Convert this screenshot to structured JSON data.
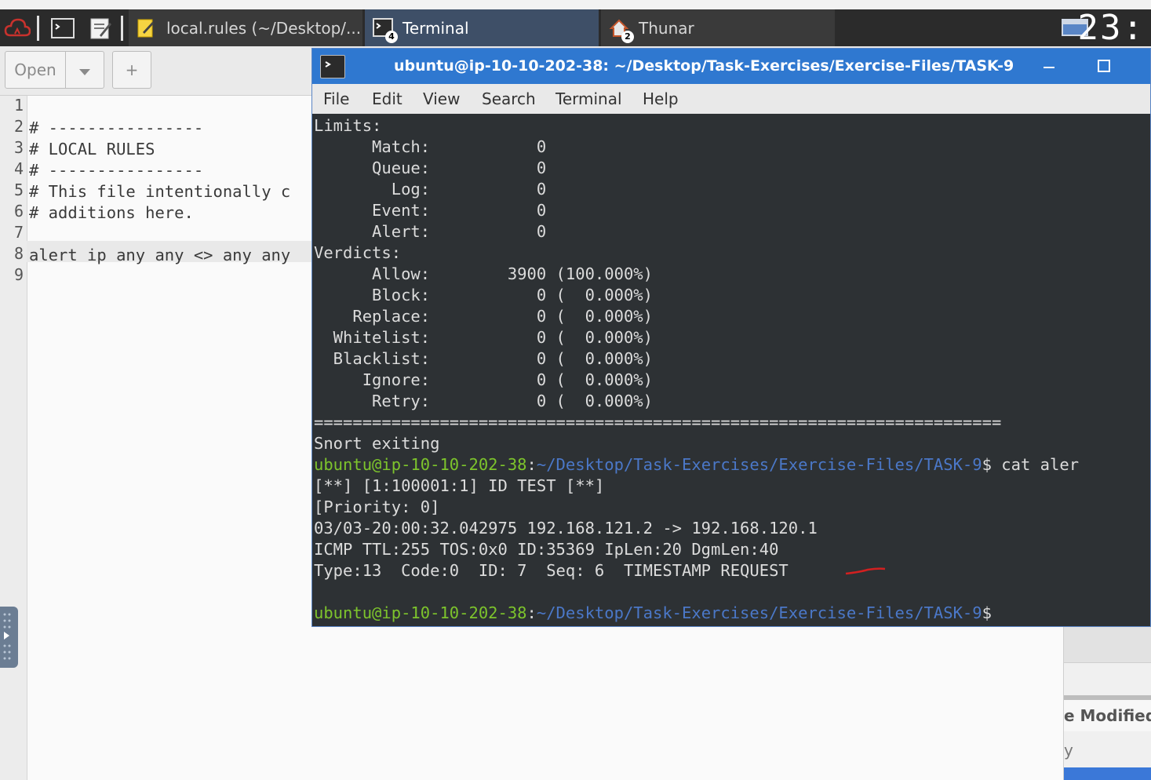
{
  "panel": {
    "tasks": [
      {
        "label": "local.rules (~/Desktop/...",
        "icon": "text-editor-icon"
      },
      {
        "label": "Terminal",
        "icon": "terminal-icon",
        "badge": "4"
      },
      {
        "label": "Thunar",
        "icon": "home-folder-icon",
        "badge": "2"
      }
    ],
    "clock": "23:"
  },
  "editor": {
    "toolbar": {
      "open_label": "Open",
      "new_label": "+"
    },
    "line_numbers": [
      "1",
      "2",
      "3",
      "4",
      "5",
      "6",
      "7",
      "8",
      "9"
    ],
    "lines": [
      "",
      "# ----------------",
      "# LOCAL RULES",
      "# ----------------",
      "# This file intentionally c",
      "# additions here.",
      "",
      "alert ip any any <> any any",
      ""
    ]
  },
  "side_window": {
    "header": "e Modified",
    "row": "y"
  },
  "terminal": {
    "title": "ubuntu@ip-10-10-202-38: ~/Desktop/Task-Exercises/Exercise-Files/TASK-9",
    "menu": [
      "File",
      "Edit",
      "View",
      "Search",
      "Terminal",
      "Help"
    ],
    "lines": [
      "Limits:",
      "      Match:           0",
      "      Queue:           0",
      "        Log:           0",
      "      Event:           0",
      "      Alert:           0",
      "Verdicts:",
      "      Allow:        3900 (100.000%)",
      "      Block:           0 (  0.000%)",
      "    Replace:           0 (  0.000%)",
      "  Whitelist:           0 (  0.000%)",
      "  Blacklist:           0 (  0.000%)",
      "     Ignore:           0 (  0.000%)",
      "      Retry:           0 (  0.000%)",
      "=======================================================================",
      "Snort exiting"
    ],
    "prompt_user": "ubuntu@ip-10-10-202-38",
    "prompt_colon": ":",
    "prompt_path": "~/Desktop/Task-Exercises/Exercise-Files/TASK-9",
    "prompt_symbol": "$",
    "command": " cat aler",
    "alert_lines": [
      "[**] [1:100001:1] ID TEST [**]",
      "[Priority: 0]",
      "03/03-20:00:32.042975 192.168.121.2 -> 192.168.120.1",
      "ICMP TTL:255 TOS:0x0 ID:35369 IpLen:20 DgmLen:40",
      "Type:13  Code:0  ID: 7  Seq: 6  TIMESTAMP REQUEST"
    ],
    "annotation_color": "#d22020"
  }
}
